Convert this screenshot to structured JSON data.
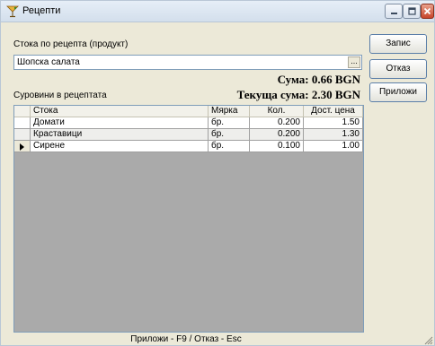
{
  "window": {
    "title": "Рецепти"
  },
  "form": {
    "product_label": "Стока по рецепта (продукт)",
    "product_value": "Шопска салата",
    "browse_label": "...",
    "materials_label": "Суровини в рецептата",
    "sum_text": "Сума: 0.66 BGN",
    "current_sum_text": "Текуща сума: 2.30 BGN"
  },
  "buttons": {
    "save": "Запис",
    "cancel": "Отказ",
    "apply": "Приложи"
  },
  "grid": {
    "columns": [
      "Стока",
      "Мярка",
      "Кол.",
      "Дост. цена"
    ],
    "rows": [
      {
        "name": "Домати",
        "unit": "бр.",
        "qty": "0.200",
        "price": "1.50"
      },
      {
        "name": "Краставици",
        "unit": "бр.",
        "qty": "0.200",
        "price": "1.30"
      },
      {
        "name": "Сирене",
        "unit": "бр.",
        "qty": "0.100",
        "price": "1.00"
      }
    ],
    "current_row_index": 2
  },
  "status_bar": {
    "text": "Приложи - F9 / Отказ - Esc"
  },
  "icons": {
    "title": "cocktail-glass-icon",
    "minimize": "minimize-icon",
    "maximize": "maximize-icon",
    "close": "close-icon",
    "row_indicator": "current-row-arrow-icon",
    "resize": "resize-grip-icon"
  }
}
